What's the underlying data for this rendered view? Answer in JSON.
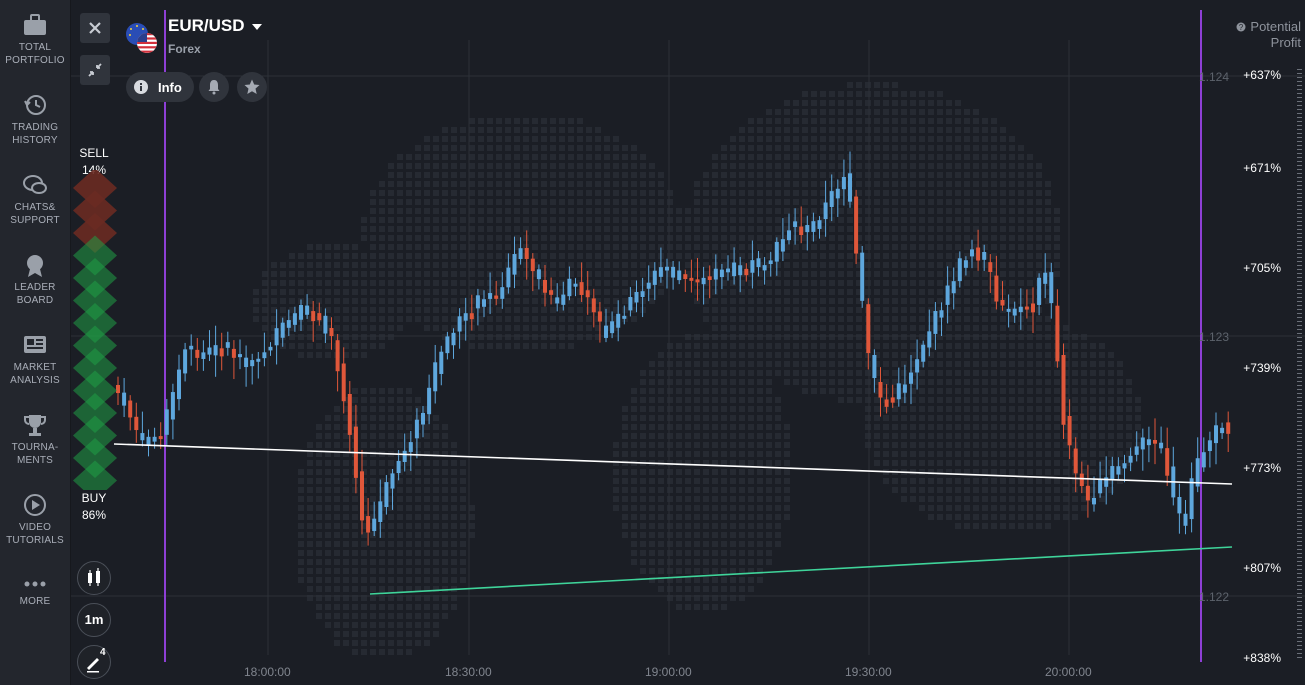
{
  "nav": [
    {
      "icon": "briefcase-icon",
      "label": "TOTAL\nPORTFOLIO"
    },
    {
      "icon": "history-icon",
      "label": "TRADING\nHISTORY"
    },
    {
      "icon": "chat-icon",
      "label": "CHATS&\nSUPPORT"
    },
    {
      "icon": "medal-icon",
      "label": "LEADER\nBOARD"
    },
    {
      "icon": "newspaper-icon",
      "label": "MARKET\nANALYSIS"
    },
    {
      "icon": "trophy-icon",
      "label": "TOURNA-\nMENTS"
    },
    {
      "icon": "play-icon",
      "label": "VIDEO\nTUTORIALS"
    },
    {
      "icon": "more-icon",
      "label": "MORE"
    }
  ],
  "asset": {
    "name": "EUR/USD",
    "category": "Forex",
    "info_label": "Info"
  },
  "sentiment": {
    "sell_label": "SELL",
    "sell_pct": "14%",
    "buy_label": "BUY",
    "buy_pct": "86%",
    "sell_fraction": 0.14
  },
  "tools": {
    "timeframe": "1m",
    "drawings_count": "4"
  },
  "profit": {
    "header": "Potential\nProfit",
    "labels": [
      "+637%",
      "+671%",
      "+705%",
      "+739%",
      "+773%",
      "+807%",
      "+838%"
    ]
  },
  "axis": {
    "price_labels": [
      "1.124",
      "1.123",
      "1.122"
    ],
    "time_labels": [
      "18:00:00",
      "18:30:00",
      "19:00:00",
      "19:30:00",
      "20:00:00"
    ]
  },
  "colors": {
    "up": "#5ea7dd",
    "down": "#e0573a",
    "trendline_white": "#ffffff",
    "trendline_green": "#3fd49a",
    "marker_purple": "#8e3fd6",
    "sell_green": "#1f9e46"
  }
}
